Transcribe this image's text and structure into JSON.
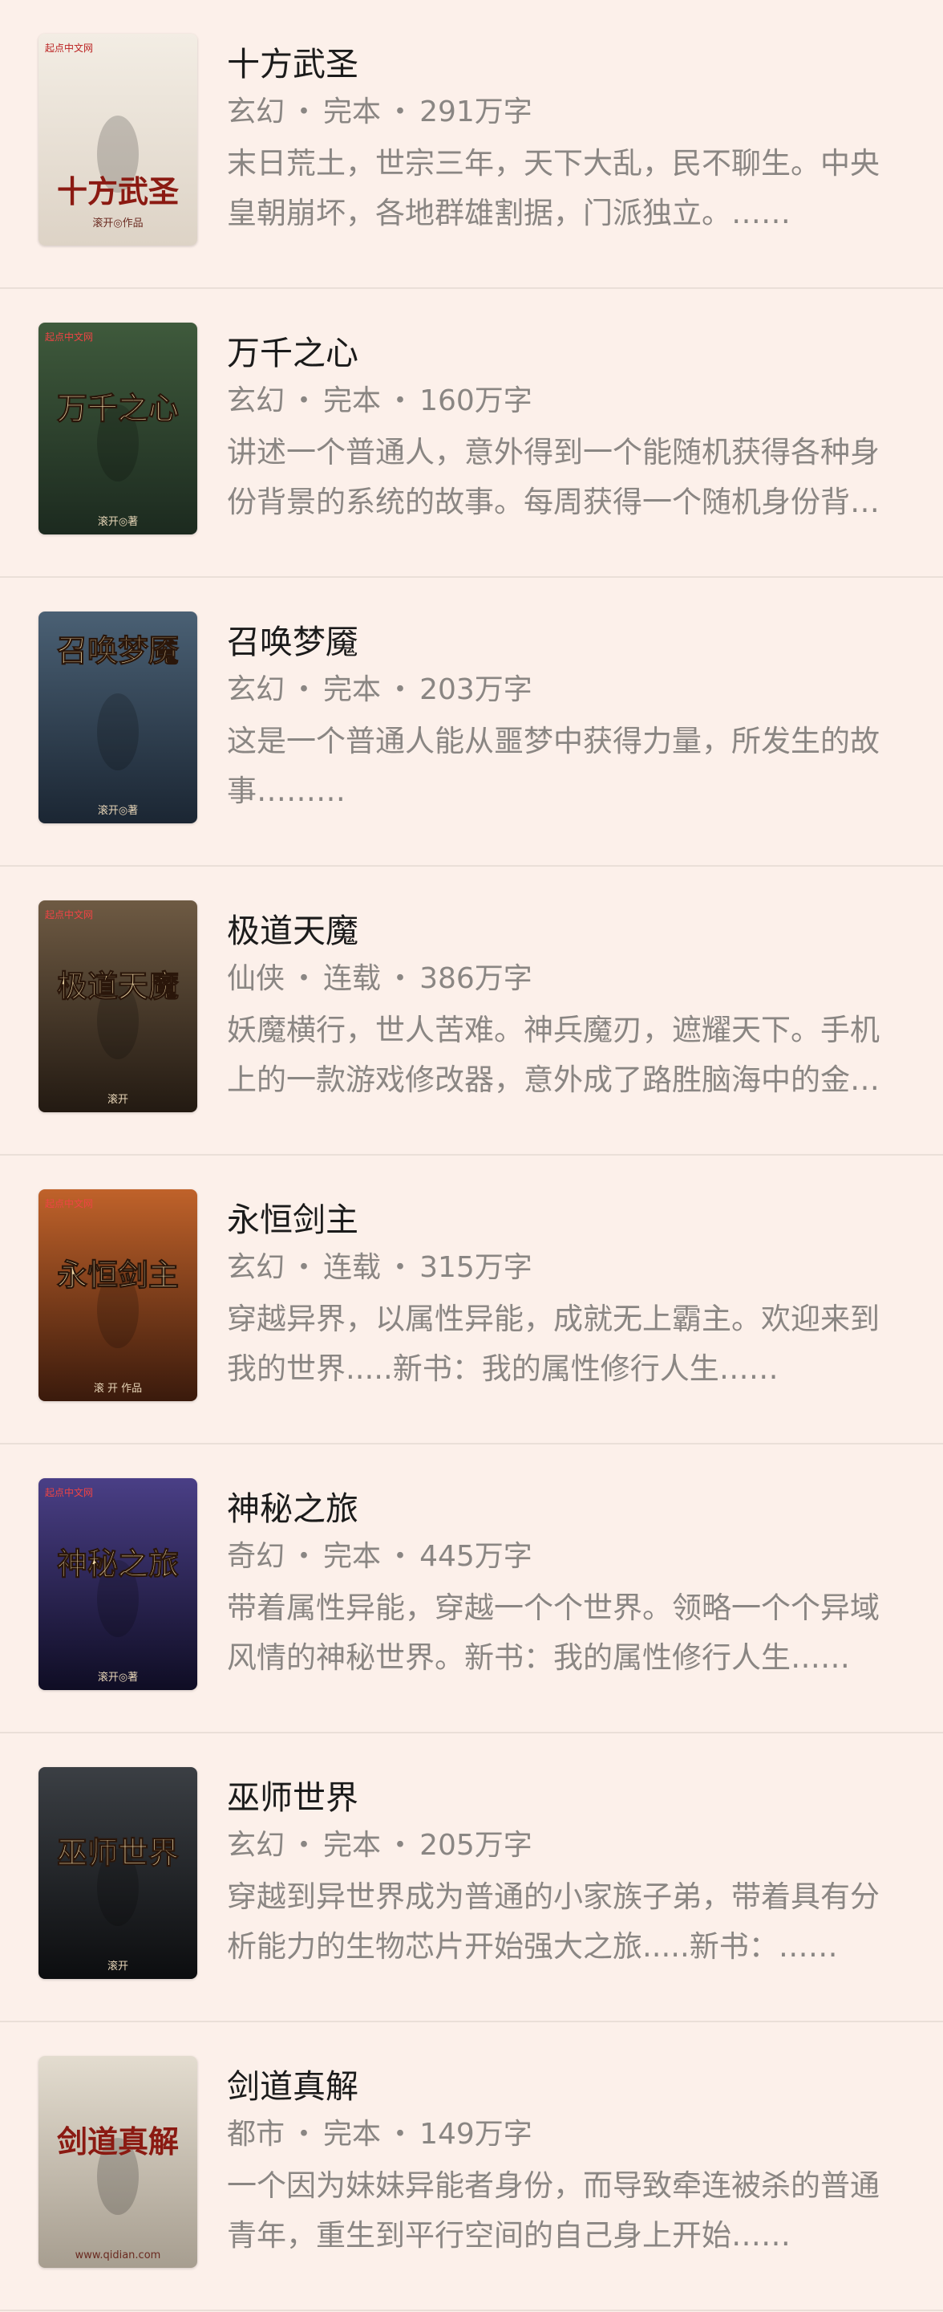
{
  "books": [
    {
      "title": "十方武圣",
      "genre": "玄幻",
      "status": "完本",
      "words": "291万字",
      "desc": "末日荒土，世宗三年，天下大乱，民不聊生。中央皇朝崩坏，各地群雄割据，门派独立。……",
      "cover_text": "十方武圣",
      "cover_badge": "起点中文网",
      "cover_sub": "滚开◎作品",
      "cover_colors": [
        "#f3ede4",
        "#ddd3c6"
      ],
      "cover_icon": "book-cover-shifang"
    },
    {
      "title": "万千之心",
      "genre": "玄幻",
      "status": "完本",
      "words": "160万字",
      "desc": "讲述一个普通人，意外得到一个能随机获得各种身份背景的系统的故事。每周获得一个随机身份背景……",
      "cover_text": "万千之心",
      "cover_badge": "起点中文网",
      "cover_sub": "滚开◎著",
      "cover_colors": [
        "#3f5a3c",
        "#1c2a1f"
      ],
      "cover_icon": "book-cover-wanqian"
    },
    {
      "title": "召唤梦魇",
      "genre": "玄幻",
      "status": "完本",
      "words": "203万字",
      "desc": "这是一个普通人能从噩梦中获得力量，所发生的故事………",
      "cover_text": "召唤梦魇",
      "cover_badge": "",
      "cover_sub": "滚开◎著",
      "cover_colors": [
        "#4a6074",
        "#1b2633"
      ],
      "cover_icon": "book-cover-zhaohuan"
    },
    {
      "title": "极道天魔",
      "genre": "仙侠",
      "status": "连载",
      "words": "386万字",
      "desc": "妖魔横行，世人苦难。神兵魔刃，遮耀天下。手机上的一款游戏修改器，意外成了路胜脑海中的金手指……",
      "cover_text": "极道天魔",
      "cover_badge": "起点中文网",
      "cover_sub": "滚开",
      "cover_colors": [
        "#6e5a43",
        "#231a12"
      ],
      "cover_icon": "book-cover-jidao"
    },
    {
      "title": "永恒剑主",
      "genre": "玄幻",
      "status": "连载",
      "words": "315万字",
      "desc": "穿越异界，以属性异能，成就无上霸主。欢迎来到我的世界.....新书：我的属性修行人生……",
      "cover_text": "永恒剑主",
      "cover_badge": "起点中文网",
      "cover_sub": "滚 开 作品",
      "cover_colors": [
        "#c0622a",
        "#3a1a0c"
      ],
      "cover_icon": "book-cover-yongheng"
    },
    {
      "title": "神秘之旅",
      "genre": "奇幻",
      "status": "完本",
      "words": "445万字",
      "desc": "带着属性异能，穿越一个个世界。领略一个个异域风情的神秘世界。新书：我的属性修行人生……",
      "cover_text": "神秘之旅",
      "cover_badge": "起点中文网",
      "cover_sub": "滚开◎著",
      "cover_colors": [
        "#4a3f86",
        "#0f0d24"
      ],
      "cover_icon": "book-cover-shenmi"
    },
    {
      "title": "巫师世界",
      "genre": "玄幻",
      "status": "完本",
      "words": "205万字",
      "desc": "穿越到异世界成为普通的小家族子弟，带着具有分析能力的生物芯片开始强大之旅.....新书：……",
      "cover_text": "巫师世界",
      "cover_badge": "",
      "cover_sub": "滚开",
      "cover_colors": [
        "#3b3f44",
        "#0c0d0f"
      ],
      "cover_icon": "book-cover-wushi"
    },
    {
      "title": "剑道真解",
      "genre": "都市",
      "status": "完本",
      "words": "149万字",
      "desc": "一个因为妹妹异能者身份，而导致牵连被杀的普通青年，重生到平行空间的自己身上开始……",
      "cover_text": "剑道真解",
      "cover_badge": "",
      "cover_sub": "www.qidian.com",
      "cover_colors": [
        "#e3dccf",
        "#a79e90"
      ],
      "cover_icon": "book-cover-jiandao"
    }
  ],
  "separator": "・"
}
